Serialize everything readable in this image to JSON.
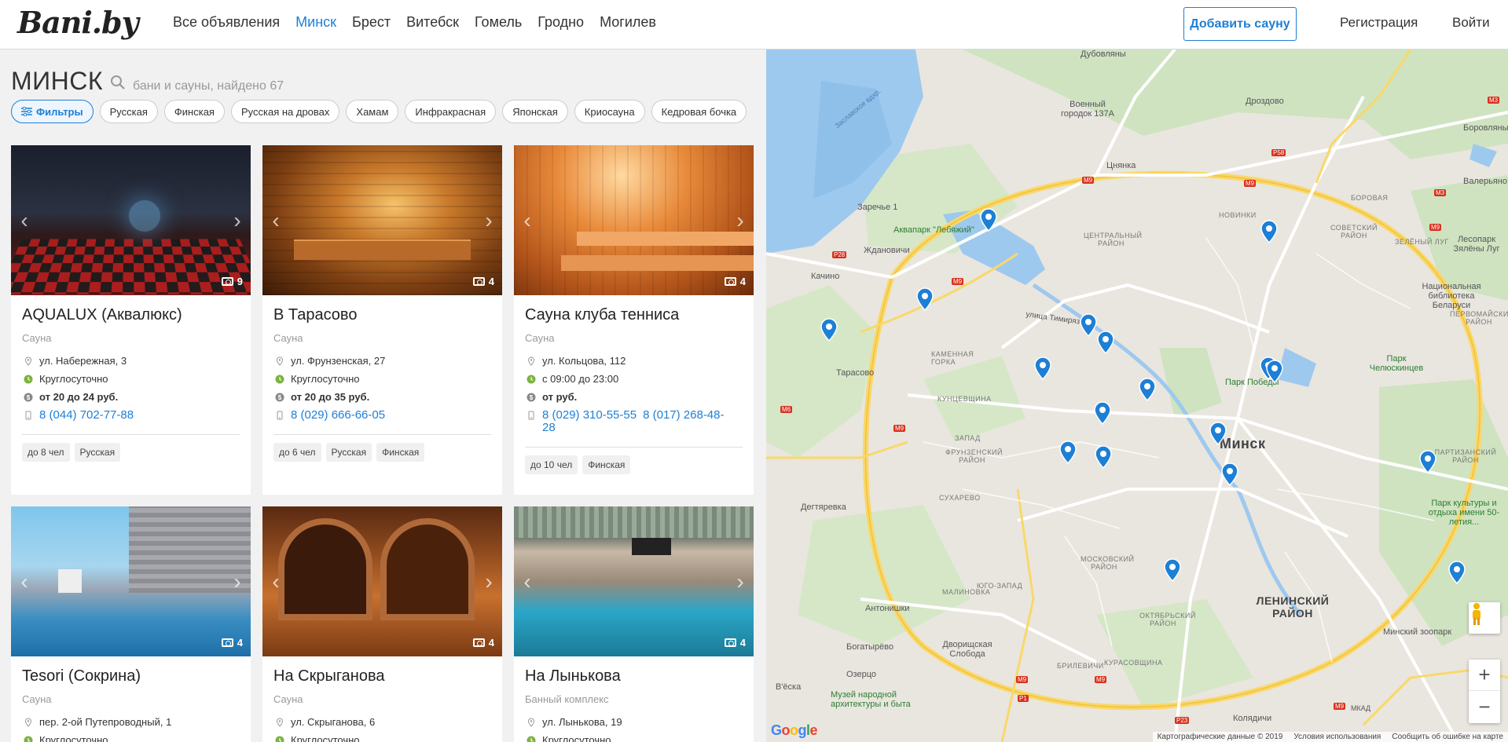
{
  "header": {
    "logo": "Bani.by",
    "nav": [
      "Все объявления",
      "Минск",
      "Брест",
      "Витебск",
      "Гомель",
      "Гродно",
      "Могилев"
    ],
    "add_button": "Добавить сауну",
    "register": "Регистрация",
    "login": "Войти"
  },
  "listing": {
    "city": "МИНСК",
    "found": "бани и сауны, найдено 67",
    "filters_button": "Фильтры",
    "filter_chips": [
      "Русская",
      "Финская",
      "Русская на дровах",
      "Хамам",
      "Инфракрасная",
      "Японская",
      "Криосауна",
      "Кедровая бочка"
    ]
  },
  "cards": [
    {
      "title": "AQUALUX (Аквалюкс)",
      "type": "Сауна",
      "address": "ул. Набережная, 3",
      "hours": "Круглосуточно",
      "price": "от 20 до 24 руб.",
      "phones": [
        "8 (044) 702-77-88"
      ],
      "tags": [
        "до 8 чел",
        "Русская"
      ],
      "photos": "9"
    },
    {
      "title": "В Тарасово",
      "type": "Сауна",
      "address": "ул. Фрунзенская, 27",
      "hours": "Круглосуточно",
      "price": "от 20 до 35 руб.",
      "phones": [
        "8 (029) 666-66-05"
      ],
      "tags": [
        "до 6 чел",
        "Русская",
        "Финская"
      ],
      "photos": "4"
    },
    {
      "title": "Сауна клуба тенниса",
      "type": "Сауна",
      "address": "ул. Кольцова, 112",
      "hours": "с 09:00 до 23:00",
      "price": "от руб.",
      "phones": [
        "8 (029) 310-55-55",
        "8 (017) 268-48-28"
      ],
      "tags": [
        "до 10 чел",
        "Финская"
      ],
      "photos": "4"
    },
    {
      "title": "Tesori (Сокрина)",
      "type": "Сауна",
      "address": "пер. 2-ой Путепроводный, 1",
      "hours": "Круглосуточно",
      "photos": "4"
    },
    {
      "title": "На Скрыганова",
      "type": "Сауна",
      "address": "ул. Скрыганова, 6",
      "hours": "Круглосуточно",
      "photos": "4"
    },
    {
      "title": "На Лынькова",
      "type": "Банный комплекс",
      "address": "ул. Лынькова, 19",
      "hours": "Круглосуточно",
      "photos": "4"
    }
  ],
  "map": {
    "city_label": "Минск",
    "labels": {
      "dubovlyany": "Дубовляны",
      "military_town": "Военный городок 137А",
      "drozdovo": "Дроздово",
      "tsnyanka": "Цнянка",
      "borovlyany": "Боровляны",
      "valeryanovo": "Валерьяно",
      "zarechye": "Заречье 1",
      "aquapark": "Аквапарк \"Лебяжий\"",
      "zhdanovichi": "Ждановичи",
      "kachino": "Качино",
      "tarasovo": "Тарасово",
      "timiryazeva": "улица Тимирязева",
      "kamennaya_gorka": "КАМЕННАЯ ГОРКА",
      "kuntsevshchina": "КУНЦЕВЩИНА",
      "zapad": "ЗАПАД",
      "frunzensky": "ФРУНЗЕНСКИЙ РАЙОН",
      "sukharevo": "СУХАРЕВО",
      "dyatlovka": "Дегтяревка",
      "moskovsky": "МОСКОВСКИЙ РАЙОН",
      "yugo_zapad": "ЮГО-ЗАПАД",
      "malinovka": "МАЛИНОВКА",
      "antonishki": "Антонишки",
      "bogatyryovo": "Богатырёво",
      "dvorishcha": "Дворищская Слобода",
      "ozertso": "Озерцо",
      "vyoska": "В'ёска",
      "museum": "Музей народной архитектуры и быта",
      "brilevichi": "БРИЛЕВИЧИ",
      "kurasovshchina": "КУРАСОВЩИНА",
      "oktyabrsky": "ОКТЯБРЬСКИЙ РАЙОН",
      "leninsky": "ЛЕНИНСКИЙ РАЙОН",
      "koliadichi": "Колядичи",
      "zoo": "Минский зоопарк",
      "park_50": "Парк культуры и отдыха имени 50-летия...",
      "partizansky": "ПАРТИЗАНСКИЙ РАЙОН",
      "park_chelyuskintsev": "Парк Челюскинцев",
      "park_pobedy": "Парк Победы",
      "library": "Национальная библиотека Беларуси",
      "pervomaisky": "ПЕРВОМАЙСКИЙ РАЙОН",
      "zeleny_lug": "ЗЕЛЁНЫЙ ЛУГ",
      "sovetsky": "СОВЕТСКИЙ РАЙОН",
      "novinki": "НОВИНКИ",
      "tsentralny": "ЦЕНТРАЛЬНЫЙ РАЙОН",
      "borovaya": "БОРОВАЯ",
      "lesopark": "Лесопарк Зялёны Луг",
      "zaslavsky": "Заславское вдхр."
    },
    "roads": {
      "m3": "M3",
      "p58": "P58",
      "m9": "M9",
      "p28": "P28",
      "m6": "M6",
      "p1": "P1",
      "p23": "P23",
      "mkad": "МКАД"
    },
    "zoom_in": "+",
    "zoom_out": "−",
    "google": "Google",
    "footer": {
      "data": "Картографические данные © 2019",
      "terms": "Условия использования",
      "report": "Сообщить об ошибке на карте"
    }
  }
}
